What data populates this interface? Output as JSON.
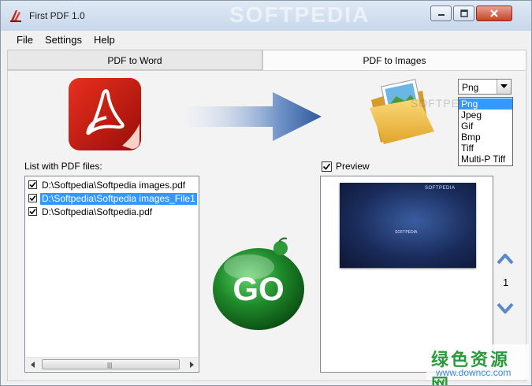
{
  "window": {
    "title": "First PDF 1.0",
    "watermark": "SOFTPEDIA"
  },
  "menubar": {
    "items": [
      "File",
      "Settings",
      "Help"
    ]
  },
  "tabs": [
    {
      "label": "PDF to Word",
      "active": false
    },
    {
      "label": "PDF to Images",
      "active": true
    }
  ],
  "format_select": {
    "selected": "Png",
    "options": [
      "Png",
      "Jpeg",
      "Gif",
      "Bmp",
      "Tiff",
      "Multi-P Tiff"
    ]
  },
  "file_list": {
    "label": "List with PDF files:",
    "files": [
      {
        "path": "D:\\Softpedia\\Softpedia images.pdf",
        "checked": true,
        "selected": false
      },
      {
        "path": "D:\\Softpedia\\Softpedia images_File1",
        "checked": true,
        "selected": true
      },
      {
        "path": "D:\\Softpedia\\Softpedia.pdf",
        "checked": true,
        "selected": false
      }
    ]
  },
  "go_button": {
    "label": "GO"
  },
  "preview": {
    "label": "Preview",
    "checked": true,
    "page": "1",
    "thumbnail_text": "SOFTPEDIA"
  },
  "watermark_overlay": {
    "folder_text": "SOFTPEDIA",
    "chinese": "绿色资源网",
    "url": "www.downcc.com"
  },
  "colors": {
    "selection": "#3399ff",
    "go_green": "#1f8a2a",
    "nav_blue": "#5a88c8"
  }
}
